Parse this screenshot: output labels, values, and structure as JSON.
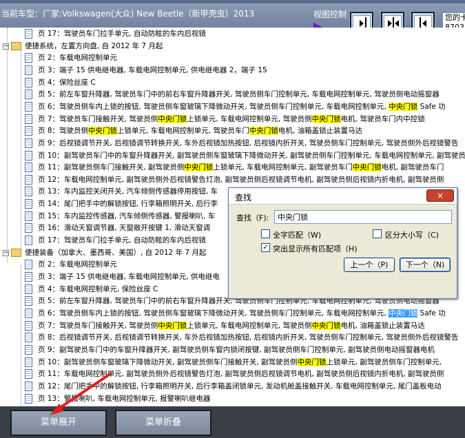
{
  "header": {
    "car_model": "当前车型：厂家:Volkswagen(大众) New Beetle（新甲壳虫）2013",
    "view_control_label": "视图控制",
    "right_info_line1": "您的卡",
    "right_info_line2": "8703"
  },
  "tree": {
    "rows": [
      {
        "kind": "page",
        "indent": 2,
        "segments": [
          "页 17：驾驶员车门拉手单元, 自动防眩的车内后视镜"
        ]
      },
      {
        "kind": "folder",
        "indent": 0,
        "segments": [
          "便捷系统，左置方向盘, 自 2012 年 7 月起"
        ]
      },
      {
        "kind": "page",
        "indent": 2,
        "segments": [
          "页 2：车载电网控制单元"
        ]
      },
      {
        "kind": "page",
        "indent": 2,
        "segments": [
          "页 3：端子 15 供电继电器, 车载电网控制单元, 供电继电器 2，端子 15"
        ]
      },
      {
        "kind": "page",
        "indent": 2,
        "segments": [
          "页 4：保险丝座 C"
        ]
      },
      {
        "kind": "page",
        "indent": 2,
        "segments": [
          "页 5：前左车窗升降器, 驾驶员车门中的前右车窗升降器开关, 驾驶员侧车门控制单元, 车载电网控制单元, 驾驶员侧电动摇窗器"
        ]
      },
      {
        "kind": "page",
        "indent": 2,
        "segments": [
          "页 6：驾驶员侧车内上锁的按钮, 驾驶员侧车窗玻璃下降微动开关, 驾驶员侧车门控制单元, 车载电网控制单元, ",
          "中央门锁",
          " Safe 功"
        ]
      },
      {
        "kind": "page",
        "indent": 2,
        "segments": [
          "页 7：驾驶员车门接触开关, 驾驶员侧",
          "中央门锁",
          "上锁单元, 车载电网控制单元, 驾驶员侧",
          "中央门锁",
          "电机, 驾驶员车门内中控锁"
        ]
      },
      {
        "kind": "page",
        "indent": 2,
        "segments": [
          "页 8：驾驶员侧",
          "中央门锁",
          "上锁单元, 车载电网控制单元, 驾驶员车门",
          "中央门锁",
          "电机, 油箱盖锁止装置马达"
        ]
      },
      {
        "kind": "page",
        "indent": 2,
        "segments": [
          "页 9：后视镜调节开关, 后视镜调节转换开关, 车外后视镜加热按钮, 后视镜内折开关, 驾驶员侧车门控制单元, 驾驶员侧外后视镜警告"
        ]
      },
      {
        "kind": "page",
        "indent": 2,
        "segments": [
          "页 10：副驾驶员车门中的车窗升降器开关, 副驾驶员侧车窗玻璃下降微动开关, 副驾驶员侧车门控制单元, 车载电网控制单元, 副驾驶员侧电动摇窗"
        ]
      },
      {
        "kind": "page",
        "indent": 2,
        "segments": [
          "页 11：副驾驶员侧车门接触开关, 副驾驶员侧",
          "中央门锁",
          "上锁单元, 车载电网控制单元, 副驾驶员车门",
          "中央门锁",
          "电机, 副驾驶员车门"
        ]
      },
      {
        "kind": "page",
        "indent": 2,
        "segments": [
          "页 12：车载电网控制单元, 副驾驶员侧外后视镜警告灯泡, 副驾驶员侧后视镜调节电机, 副驾驶员侧后视镜内折电机, 副驾驶员侧"
        ]
      },
      {
        "kind": "page",
        "indent": 2,
        "segments": [
          "页 13：车内监控关闭开关, 汽车倾侧传感器停用按钮, 车"
        ]
      },
      {
        "kind": "page",
        "indent": 2,
        "segments": [
          "页 14：尾门把手中的解锁按钮, 行李箱照明开关, 后行李"
        ]
      },
      {
        "kind": "page",
        "indent": 2,
        "segments": [
          "页 15：车内监控传感器, 汽车倾侧传感器, 警报喇叭, 车"
        ]
      },
      {
        "kind": "page",
        "indent": 2,
        "segments": [
          "页 16：滑动天窗调节器, 天窗敞开按键 1, 滑动天窗调"
        ]
      },
      {
        "kind": "page",
        "indent": 2,
        "segments": [
          "页 17：驾驶员车门拉手单元, 自动防眩的车内后视镜"
        ]
      },
      {
        "kind": "folder",
        "indent": 0,
        "segments": [
          "便捷装备（加拿大、墨西哥、美国）, 自 2012 年 7 月起"
        ]
      },
      {
        "kind": "page",
        "indent": 2,
        "segments": [
          "页 2：车载电网控制单元"
        ]
      },
      {
        "kind": "page",
        "indent": 2,
        "segments": [
          "页 3：端子 15 供电继电器, 车载电网控制单元, 供电继电"
        ]
      },
      {
        "kind": "page",
        "indent": 2,
        "segments": [
          "页 4：车载电网控制单元, 保险丝座 C"
        ]
      },
      {
        "kind": "page",
        "indent": 2,
        "segments": [
          "页 5：前左车窗升降器, 驾驶员车门中的前右车窗升降器开关, 驾驶员侧车门控制单元, 车载电网控制单元, 驾驶员侧电动摇窗器"
        ]
      },
      {
        "kind": "page",
        "indent": 2,
        "segments": [
          "页 6：驾驶员侧车内上锁的按钮, 驾驶员侧车窗玻璃下降微动开关, 驾驶员侧车门控制单元, 车载电网控制单元, ",
          "中央门锁",
          " Safe 功"
        ],
        "selected_index": 1
      },
      {
        "kind": "page",
        "indent": 2,
        "segments": [
          "页 7：驾驶员车门接触开关, 驾驶员侧",
          "中央门锁",
          "上锁单元, 车载电网控制单元, 驾驶员侧",
          "中央门锁",
          "电机, 油箱盖锁止装置马达"
        ]
      },
      {
        "kind": "page",
        "indent": 2,
        "segments": [
          "页 8：后视镜调节开关, 后视镜调节转换开关, 车外后视镜加热按钮, 后视镜内折开关, 驾驶员侧车门控制单元, 驾驶员侧外后视镜警告"
        ]
      },
      {
        "kind": "page",
        "indent": 2,
        "segments": [
          "页 9：副驾驶员车门中的车窗升降器开关, 副驾驶员侧车窗内锁闭按键, 副驾驶员侧车门控制单元, 副驾驶员侧电动摇窗器电机"
        ]
      },
      {
        "kind": "page",
        "indent": 2,
        "segments": [
          "页 10：副驾驶员侧车窗玻璃下降微动开关, 副驾驶员侧车门接触开关, 副驾驶员侧",
          "中央门锁",
          "上锁单元, 副驾驶员侧车门控制单元,"
        ]
      },
      {
        "kind": "page",
        "indent": 2,
        "segments": [
          "页 11：车载电网控制单元, 副驾驶员侧外后视镜警告灯泡, 副驾驶员侧后视镜调节电机, 副驾驶员侧后视镜内折电机, 副驾驶员侧"
        ]
      },
      {
        "kind": "page",
        "indent": 2,
        "segments": [
          "页 12：尾门把手中的解锁按钮, 行李箱照明开关, 后行李箱盖闭锁单元, 发动机舱盖接触开关, 车载电网控制单元, 尾门盖板电动"
        ]
      },
      {
        "kind": "page",
        "indent": 2,
        "segments": [
          "页 13：警报喇叭, 车载电网控制单元, 报警喇叭继电器"
        ]
      }
    ]
  },
  "find_dialog": {
    "title": "查找",
    "close_label": "×",
    "find_label": "查找（F):",
    "find_value": "中央门锁",
    "whole_word_label": "全字匹配（W)",
    "whole_word_checked": false,
    "match_case_label": "区分大小写（C)",
    "match_case_checked": false,
    "highlight_all_label": "突出显示所有匹配项（H)",
    "highlight_all_checked": true,
    "prev_button": "上一个（P)",
    "next_button": "下一个（N)"
  },
  "bottom": {
    "expand_label": "菜单展开",
    "collapse_label": "菜单折叠"
  },
  "colors": {
    "highlight": "#ffff00",
    "selected_highlight": "#3399ff",
    "header_bg": "#7a89a8",
    "bottom_bg": "#3a3e45",
    "arrow": "#e02020"
  }
}
